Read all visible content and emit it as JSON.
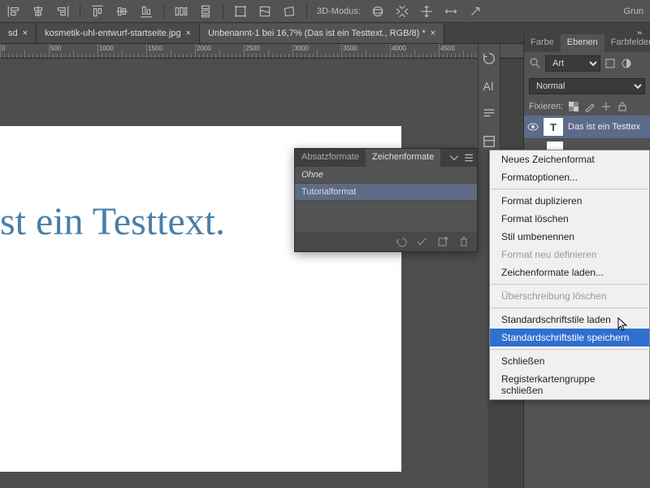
{
  "toolbar": {
    "mode3d_label": "3D-Modus:",
    "grun_label": "Grun"
  },
  "tabs": [
    {
      "label": "sd ",
      "close": "×"
    },
    {
      "label": "kosmetik-uhl-entwurf-startseite.jpg",
      "close": "×"
    },
    {
      "label": "Unbenannt-1 bei 16,7% (Das ist ein Testtext., RGB/8) *",
      "close": "×"
    }
  ],
  "ruler_marks": [
    "0",
    "500",
    "1000",
    "1500",
    "2000",
    "2500",
    "3000",
    "3500",
    "4000",
    "4500"
  ],
  "canvas": {
    "sample_text": "st ein Testtext."
  },
  "styles_panel": {
    "tab_paragraph": "Absatzformate",
    "tab_character": "Zeichenformate",
    "item_none": "Ohne",
    "item_tutorial": "Tutorialformat"
  },
  "right_panel": {
    "tab_color": "Farbe",
    "tab_layers": "Ebenen",
    "tab_swatches": "Farbfelder",
    "kind_value": "Art",
    "blend_value": "Normal",
    "lock_label": "Fixieren:",
    "layer1_name": "Das ist ein Testtex",
    "layer1_thumb_letter": "T"
  },
  "context_menu": {
    "new_char_format": "Neues Zeichenformat",
    "format_options": "Formatoptionen...",
    "duplicate": "Format duplizieren",
    "delete": "Format löschen",
    "rename": "Stil umbenennen",
    "redefine": "Format neu definieren",
    "load_char": "Zeichenformate laden...",
    "clear_override": "Überschreibung löschen",
    "load_default": "Standardschriftstile laden",
    "save_default": "Standardschriftstile speichern",
    "close": "Schließen",
    "close_group": "Registerkartengruppe schließen"
  }
}
